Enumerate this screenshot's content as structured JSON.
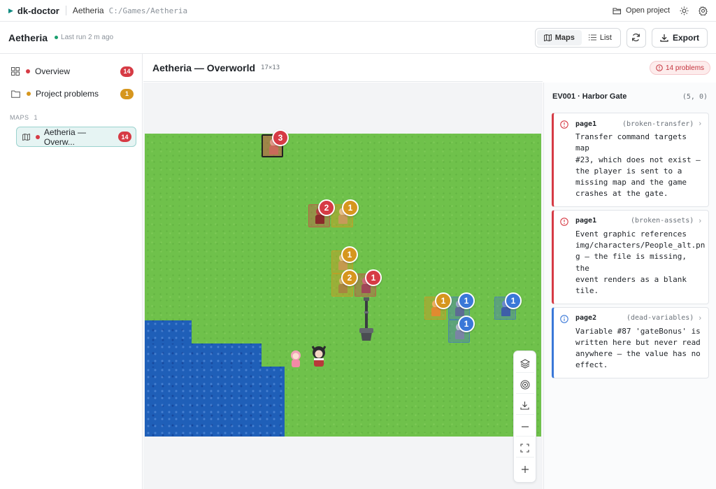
{
  "topbar": {
    "brand": "dk-doctor",
    "project": "Aetheria",
    "path": "C:/Games/Aetheria",
    "open_project": "Open project"
  },
  "header": {
    "title": "Aetheria",
    "last_run": "Last run 2 m ago",
    "view_maps": "Maps",
    "view_list": "List",
    "export": "Export"
  },
  "sidebar": {
    "items": [
      {
        "label": "Overview",
        "count": "14",
        "dot": "#d63b45",
        "badge": "#d63b45"
      },
      {
        "label": "Project problems",
        "count": "1",
        "dot": "#d6961e",
        "badge": "#d6961e"
      }
    ],
    "maps_label": "MAPS",
    "maps_count": "1",
    "map_item": {
      "label": "Aetheria — Overw...",
      "count": "14"
    }
  },
  "map": {
    "title": "Aetheria — Overworld",
    "size": "17×13",
    "problems": "14 problems",
    "markers": [
      "3",
      "2",
      "1",
      "1",
      "2",
      "1",
      "1",
      "1",
      "1",
      "1"
    ]
  },
  "panel": {
    "title": "EV001 · Harbor Gate",
    "coords": "(5, 0)",
    "cards": [
      {
        "page": "page1",
        "code": "(broken-transfer)",
        "severity": "error",
        "message_lines": [
          "Transfer command targets map",
          "#23, which does not exist —",
          "the player is sent to a",
          "missing map and the game",
          "crashes at the gate."
        ]
      },
      {
        "page": "page1",
        "code": "(broken-assets)",
        "severity": "error",
        "message_lines": [
          "Event graphic references",
          "img/characters/People_alt.pn",
          "g — the file is missing, the",
          "event renders as a blank",
          "tile."
        ]
      },
      {
        "page": "page2",
        "code": "(dead-variables)",
        "severity": "info",
        "message_lines": [
          "Variable #87 'gateBonus' is",
          "written here but never read",
          "anywhere — the value has no",
          "effect."
        ]
      }
    ]
  },
  "colors": {
    "error": "#d63b45",
    "warning": "#d6961e",
    "info": "#3a78d8",
    "accent": "#0f8a80",
    "water": "#1f5fb8",
    "grass": "#6fc14b"
  }
}
